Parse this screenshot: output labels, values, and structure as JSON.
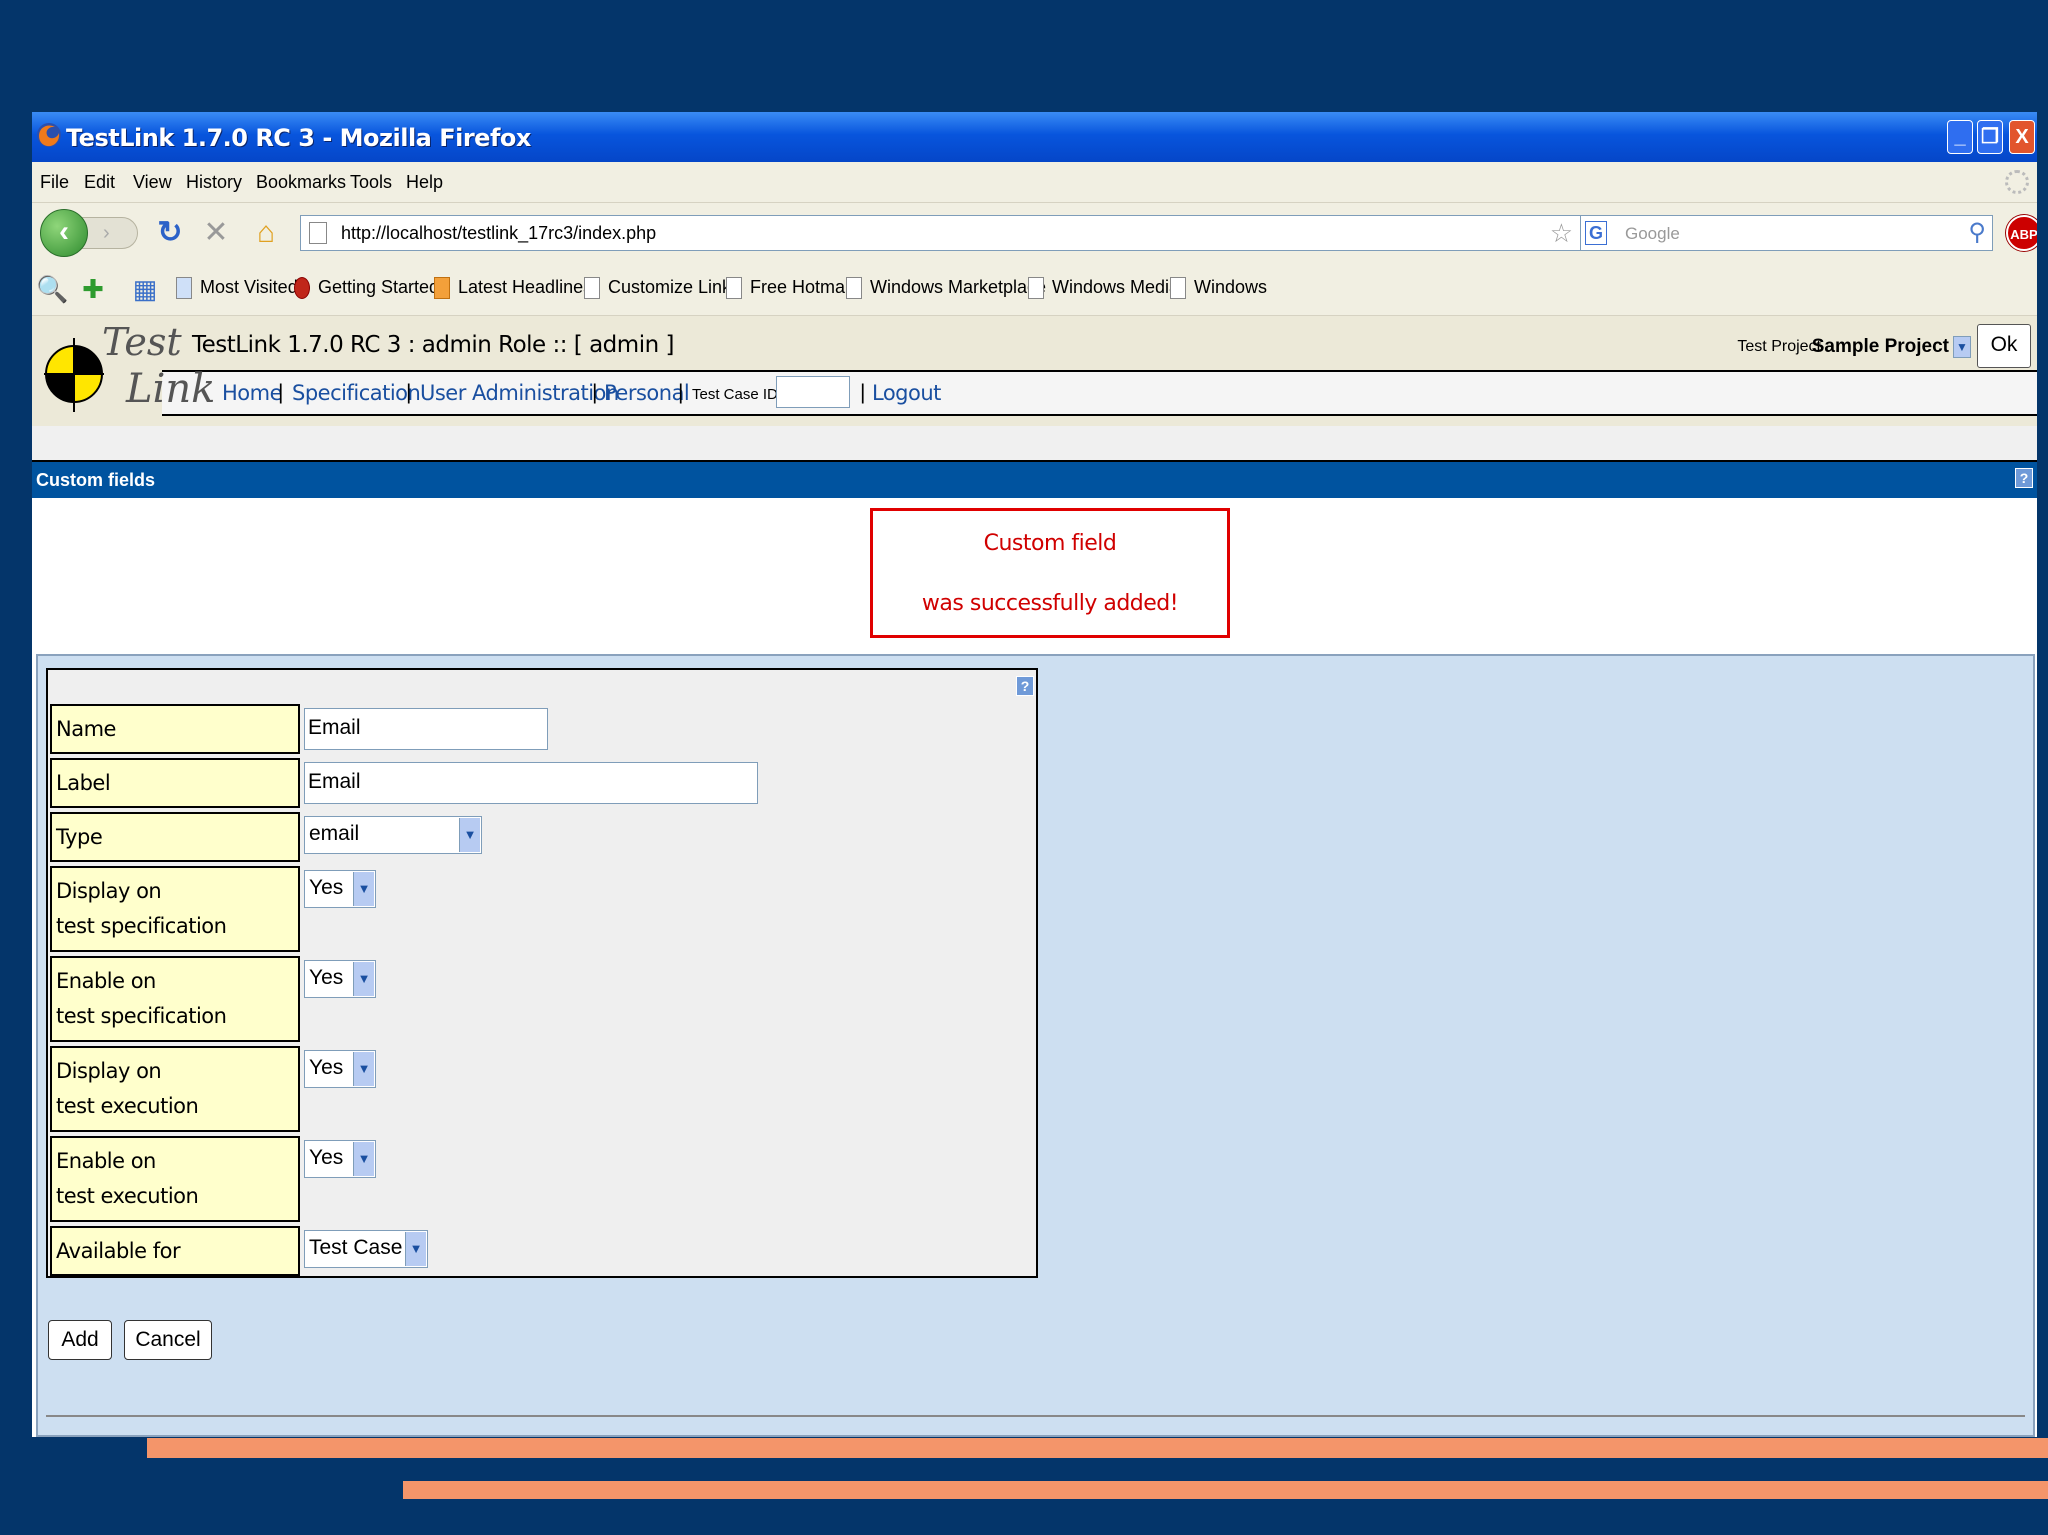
{
  "window": {
    "title": "TestLink 1.7.0 RC 3 - Mozilla Firefox",
    "controls": {
      "minimize": "_",
      "maximize": "❐",
      "close": "X"
    }
  },
  "menubar": {
    "items": [
      "File",
      "Edit",
      "View",
      "History",
      "Bookmarks",
      "Tools",
      "Help"
    ]
  },
  "navbar": {
    "url": "http://localhost/testlink_17rc3/index.php",
    "search_placeholder": "Google",
    "search_engine_icon": "G",
    "adblock_label": "ABP"
  },
  "bookmarks": {
    "items": [
      "Most Visited",
      "Getting Started",
      "Latest Headlines",
      "Customize Links",
      "Free Hotmail",
      "Windows Marketplace",
      "Windows Media",
      "Windows"
    ]
  },
  "app": {
    "logo_top": "Test",
    "logo_bottom": "Link",
    "title": "TestLink 1.7.0 RC 3 : admin Role :: [ admin ]",
    "project_label": "Test Project",
    "project_name": "Sample Project",
    "ok_label": "Ok",
    "menu": {
      "home": "Home",
      "specification": "Specification",
      "user_admin": "User Administration",
      "personal": "Personal",
      "test_case_id_label": "Test Case ID:",
      "logout": "Logout",
      "separator": "|"
    }
  },
  "section": {
    "title": "Custom fields",
    "help_icon": "?"
  },
  "message": {
    "line1": "Custom field",
    "line2": "was successfully added!"
  },
  "form": {
    "help_icon": "?",
    "rows": [
      {
        "label": "Name",
        "value": "Email"
      },
      {
        "label": "Label",
        "value": "Email"
      },
      {
        "label": "Type",
        "value": "email"
      },
      {
        "label1": "Display on",
        "label2": "test specification",
        "value": "Yes"
      },
      {
        "label1": "Enable on",
        "label2": "test specification",
        "value": "Yes"
      },
      {
        "label1": "Display on",
        "label2": "test execution",
        "value": "Yes"
      },
      {
        "label1": "Enable on",
        "label2": "test execution",
        "value": "Yes"
      },
      {
        "label": "Available for",
        "value": "Test Case"
      }
    ],
    "add_label": "Add",
    "cancel_label": "Cancel"
  },
  "colors": {
    "slide_background": "#04356a",
    "accent_stripe": "#f4956a",
    "section_bar": "#00539f",
    "message_red": "#d00000",
    "label_cell": "#ffffcc",
    "workspace": "#cddff1"
  }
}
